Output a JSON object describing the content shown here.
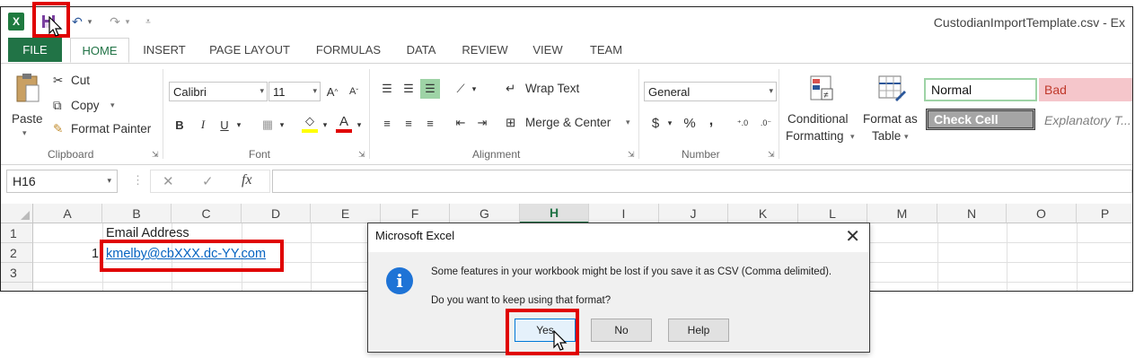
{
  "window": {
    "title": "CustodianImportTemplate.csv - Ex",
    "logo": "X"
  },
  "qat": {
    "undo_icon": "↶",
    "redo_icon": "↷",
    "more": "▾"
  },
  "tabs": {
    "file": "FILE",
    "items": [
      "HOME",
      "INSERT",
      "PAGE LAYOUT",
      "FORMULAS",
      "DATA",
      "REVIEW",
      "VIEW",
      "TEAM"
    ]
  },
  "ribbon": {
    "clipboard": {
      "paste": "Paste",
      "cut": "Cut",
      "copy": "Copy",
      "format_painter": "Format Painter",
      "group": "Clipboard"
    },
    "font": {
      "name": "Calibri",
      "size": "11",
      "bold": "B",
      "italic": "I",
      "underline": "U",
      "group": "Font"
    },
    "alignment": {
      "wrap_text": "Wrap Text",
      "merge_center": "Merge & Center",
      "group": "Alignment"
    },
    "number": {
      "format": "General",
      "dollar": "$",
      "percent": "%",
      "comma": ",",
      "group": "Number"
    },
    "styles": {
      "conditional_formatting": [
        "Conditional",
        "Formatting"
      ],
      "format_as_table": [
        "Format as",
        "Table"
      ],
      "normal": "Normal",
      "bad": "Bad",
      "check_cell": "Check Cell",
      "explanatory": "Explanatory T..."
    }
  },
  "formula_bar": {
    "name_box": "H16",
    "fx": "fx",
    "cancel": "✕",
    "enter": "✓",
    "value": ""
  },
  "grid": {
    "columns": [
      "A",
      "B",
      "C",
      "D",
      "E",
      "F",
      "G",
      "H",
      "I",
      "J",
      "K",
      "L",
      "M",
      "N",
      "O",
      "P"
    ],
    "selected_column": "H",
    "rows": [
      "1",
      "2",
      "3"
    ],
    "b1": "Email Address",
    "a2": "1",
    "b2": "kmelby@cbXXX.dc-YY.com"
  },
  "dialog": {
    "title": "Microsoft Excel",
    "close": "✕",
    "message1": "Some features in your workbook might be lost if you save it as CSV (Comma delimited).",
    "message2": "Do you want to keep using that format?",
    "yes": "Yes",
    "no": "No",
    "help": "Help",
    "icon": "i"
  }
}
